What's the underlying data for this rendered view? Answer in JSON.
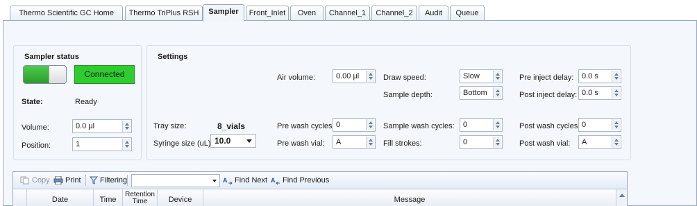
{
  "tabs": [
    {
      "label": "Thermo Scientific GC Home",
      "active": false
    },
    {
      "label": "Thermo TriPlus RSH",
      "active": false
    },
    {
      "label": "Sampler",
      "active": true
    },
    {
      "label": "Front_Inlet",
      "active": false
    },
    {
      "label": "Oven",
      "active": false
    },
    {
      "label": "Channel_1",
      "active": false
    },
    {
      "label": "Channel_2",
      "active": false
    },
    {
      "label": "Audit",
      "active": false
    },
    {
      "label": "Queue",
      "active": false
    }
  ],
  "sampler_status": {
    "title": "Sampler status",
    "toggle_on": true,
    "connection": "Connected",
    "state_label": "State:",
    "state_value": "Ready",
    "volume_label": "Volume:",
    "volume_value": "0.0 µl",
    "position_label": "Position:",
    "position_value": "1"
  },
  "settings": {
    "title": "Settings",
    "tray_size_label": "Tray size:",
    "tray_size_value": "8_vials",
    "syringe_size_label": "Syringe size (uL):",
    "syringe_size_value": "10.0",
    "air_volume_label": "Air volume:",
    "air_volume_value": "0.00 µl",
    "pre_wash_cycles_label": "Pre wash cycles:",
    "pre_wash_cycles_value": "0",
    "pre_wash_vial_label": "Pre wash vial:",
    "pre_wash_vial_value": "A",
    "draw_speed_label": "Draw speed:",
    "draw_speed_value": "Slow",
    "sample_depth_label": "Sample depth:",
    "sample_depth_value": "Bottom",
    "sample_wash_cycles_label": "Sample wash cycles:",
    "sample_wash_cycles_value": "0",
    "fill_strokes_label": "Fill strokes:",
    "fill_strokes_value": "0",
    "pre_inject_delay_label": "Pre inject delay:",
    "pre_inject_delay_value": "0.0 s",
    "post_inject_delay_label": "Post inject delay:",
    "post_inject_delay_value": "0.0 s",
    "post_wash_cycles_label": "Post wash cycles:",
    "post_wash_cycles_value": "0",
    "post_wash_vial_label": "Post wash vial:",
    "post_wash_vial_value": "A"
  },
  "log_toolbar": {
    "copy": "Copy",
    "print": "Print",
    "filtering": "Filtering",
    "filter_value": "",
    "find_next": "Find Next",
    "find_previous": "Find Previous"
  },
  "log_columns": [
    "Date",
    "Time",
    "Retention Time",
    "Device",
    "Message"
  ],
  "colors": {
    "connected": "#2ecc2e",
    "toggle_on": "#3fbf3f",
    "panel_bg": "#f4f7fb"
  }
}
